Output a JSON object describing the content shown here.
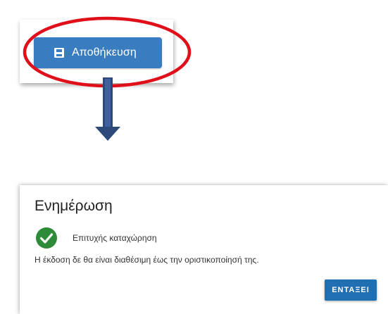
{
  "save_button": {
    "label": "Αποθήκευση",
    "icon": "save-icon",
    "color": "#3a7cc0"
  },
  "annotation": {
    "highlight_color": "#e0101a",
    "arrow_color": "#2e4a7a"
  },
  "dialog": {
    "title": "Ενημέρωση",
    "status_icon": "check-circle-icon",
    "status_color": "#2e8b3a",
    "status_text": "Επιτυχής καταχώρηση",
    "message": "Η έκδοση δε θα είναι διαθέσιμη έως την οριστικοποίησή της.",
    "ok_label": "ΕΝΤΑΞΕΙ",
    "ok_color": "#1f6fb2"
  }
}
